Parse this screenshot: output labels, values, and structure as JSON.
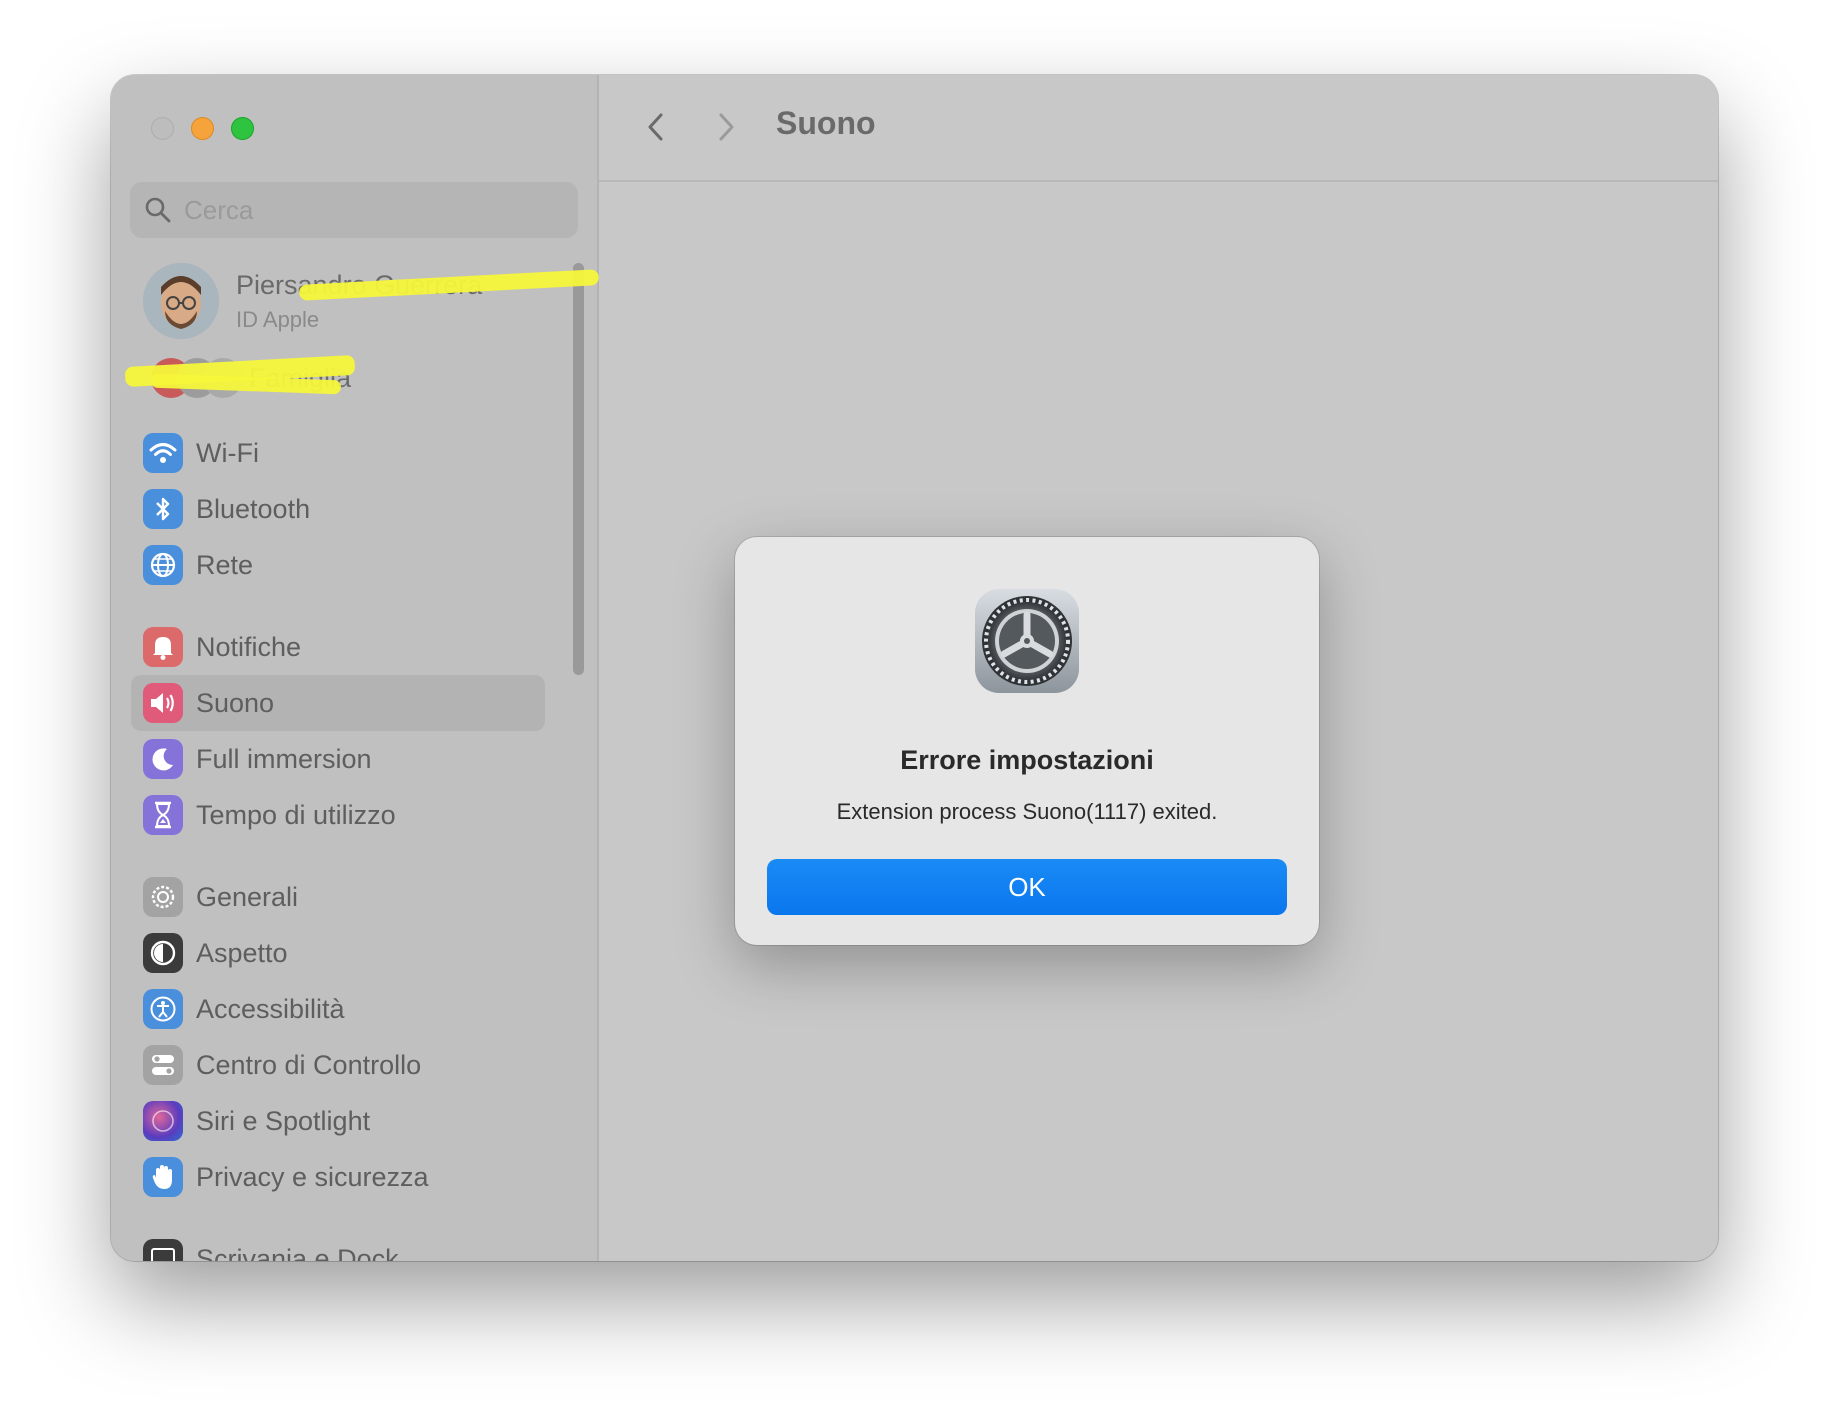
{
  "window": {
    "pane_title": "Suono"
  },
  "search": {
    "placeholder": "Cerca"
  },
  "profile": {
    "name": "Piersandro Guerrera",
    "subtitle": "ID Apple"
  },
  "family": {
    "label": "Famiglia"
  },
  "sidebar": {
    "items": [
      {
        "label": "Wi-Fi",
        "icon": "wifi-icon",
        "color": "#4a90e2"
      },
      {
        "label": "Bluetooth",
        "icon": "bluetooth-icon",
        "color": "#4a90e2"
      },
      {
        "label": "Rete",
        "icon": "globe-icon",
        "color": "#4a90e2"
      },
      {
        "label": "Notifiche",
        "icon": "bell-icon",
        "color": "#e0666c"
      },
      {
        "label": "Suono",
        "icon": "speaker-icon",
        "color": "#e05a74",
        "selected": true
      },
      {
        "label": "Full immersion",
        "icon": "moon-icon",
        "color": "#7f6fd8"
      },
      {
        "label": "Tempo di utilizzo",
        "icon": "hourglass-icon",
        "color": "#7f6fd8"
      },
      {
        "label": "Generali",
        "icon": "gear-icon",
        "color": "#9e9e9e"
      },
      {
        "label": "Aspetto",
        "icon": "appearance-icon",
        "color": "#3a3a3a"
      },
      {
        "label": "Accessibilità",
        "icon": "accessibility-icon",
        "color": "#4a90e2"
      },
      {
        "label": "Centro di Controllo",
        "icon": "toggles-icon",
        "color": "#9e9e9e"
      },
      {
        "label": "Siri e Spotlight",
        "icon": "siri-icon",
        "color": "#6b4dbb"
      },
      {
        "label": "Privacy e sicurezza",
        "icon": "hand-icon",
        "color": "#4a90e2"
      },
      {
        "label": "Scrivania e Dock",
        "icon": "dock-icon",
        "color": "#3a3a3a"
      }
    ]
  },
  "dialog": {
    "title": "Errore impostazioni",
    "message": "Extension process Suono(1117) exited.",
    "ok_label": "OK"
  }
}
